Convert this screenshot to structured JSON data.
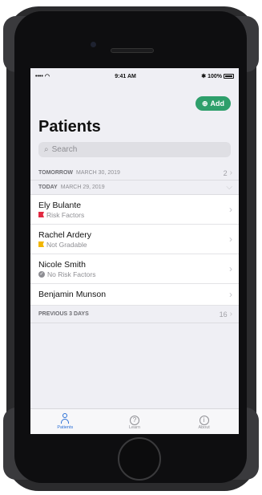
{
  "status_bar": {
    "signal": "••••",
    "time": "9:41 AM",
    "battery": "100%"
  },
  "header": {
    "add_label": "Add",
    "title": "Patients"
  },
  "search": {
    "placeholder": "Search"
  },
  "sections": {
    "tomorrow": {
      "label": "TOMORROW",
      "date": "MARCH 30, 2019",
      "count": "2"
    },
    "today": {
      "label": "TODAY",
      "date": "MARCH 29, 2019"
    },
    "previous": {
      "label": "PREVIOUS 3 DAYS",
      "count": "16"
    }
  },
  "patients": [
    {
      "name": "Ely Bulante",
      "status": "Risk Factors",
      "status_icon": "red-flag-icon"
    },
    {
      "name": "Rachel Ardery",
      "status": "Not Gradable",
      "status_icon": "yellow-flag-icon"
    },
    {
      "name": "Nicole Smith",
      "status": "No Risk Factors",
      "status_icon": "check-circle-icon"
    },
    {
      "name": "Benjamin Munson",
      "status": "",
      "status_icon": ""
    }
  ],
  "tabs": [
    {
      "label": "Patients",
      "icon": "person-icon",
      "active": true
    },
    {
      "label": "Learn",
      "icon": "question-circle-icon",
      "active": false
    },
    {
      "label": "About",
      "icon": "info-circle-icon",
      "active": false
    }
  ],
  "colors": {
    "accent_green": "#2e9f6b",
    "accent_blue": "#2b6fd6",
    "flag_red": "#e22a42",
    "flag_yellow": "#f2b600"
  }
}
